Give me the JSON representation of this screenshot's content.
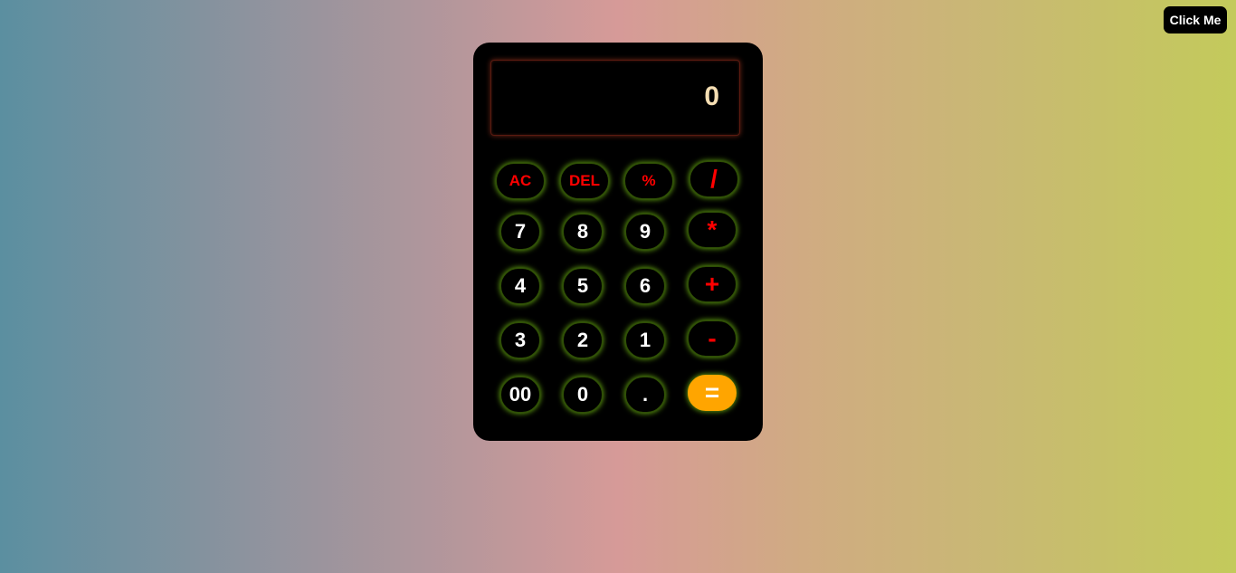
{
  "header": {
    "click_me_label": "Click Me"
  },
  "calculator": {
    "display_value": "0",
    "keys": {
      "ac": "AC",
      "del": "DEL",
      "percent": "%",
      "divide": "/",
      "seven": "7",
      "eight": "8",
      "nine": "9",
      "multiply": "*",
      "four": "4",
      "five": "5",
      "six": "6",
      "add": "+",
      "three": "3",
      "two": "2",
      "one": "1",
      "subtract": "-",
      "double_zero": "00",
      "zero": "0",
      "decimal": ".",
      "equals": "="
    }
  },
  "colors": {
    "operator_text": "#ff0000",
    "equals_bg": "#ffa500",
    "display_text": "#f5deb3",
    "glow": "#78c814"
  }
}
